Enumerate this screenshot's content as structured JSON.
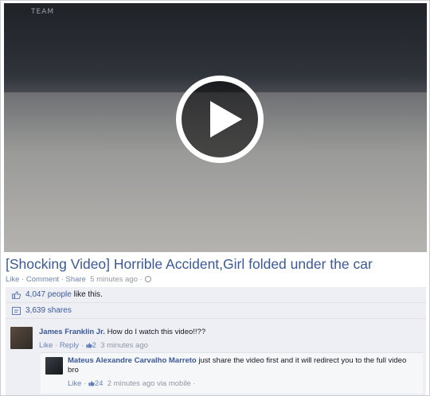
{
  "video": {
    "brand_mark": "TEAM",
    "thumbnail_note": "placeholder",
    "play_icon": "play-icon"
  },
  "post": {
    "title": "[Shocking Video] Horrible Accident,Girl folded under the car",
    "like_label": "Like",
    "comment_label": "Comment",
    "share_label": "Share",
    "timestamp": "5 minutes ago",
    "separator": "·"
  },
  "engagement": {
    "likes_count": "4,047 people",
    "likes_suffix": "like this.",
    "shares_count": "3,639 shares"
  },
  "comments": [
    {
      "author": "James Franklin Jr.",
      "text": "How do I watch this video!!??",
      "like_label": "Like",
      "reply_label": "Reply",
      "reaction_count": "2",
      "timestamp": "3 minutes ago"
    }
  ],
  "reply": {
    "author": "Mateus Alexandre Carvalho Marreto",
    "text": "just share the video first and it will redirect you to the full video bro",
    "like_label": "Like",
    "reaction_count": "24",
    "timestamp": "2 minutes ago via mobile"
  },
  "colors": {
    "link": "#3b5998",
    "meta": "#9197a3",
    "ufi_bg": "#edeff4"
  }
}
